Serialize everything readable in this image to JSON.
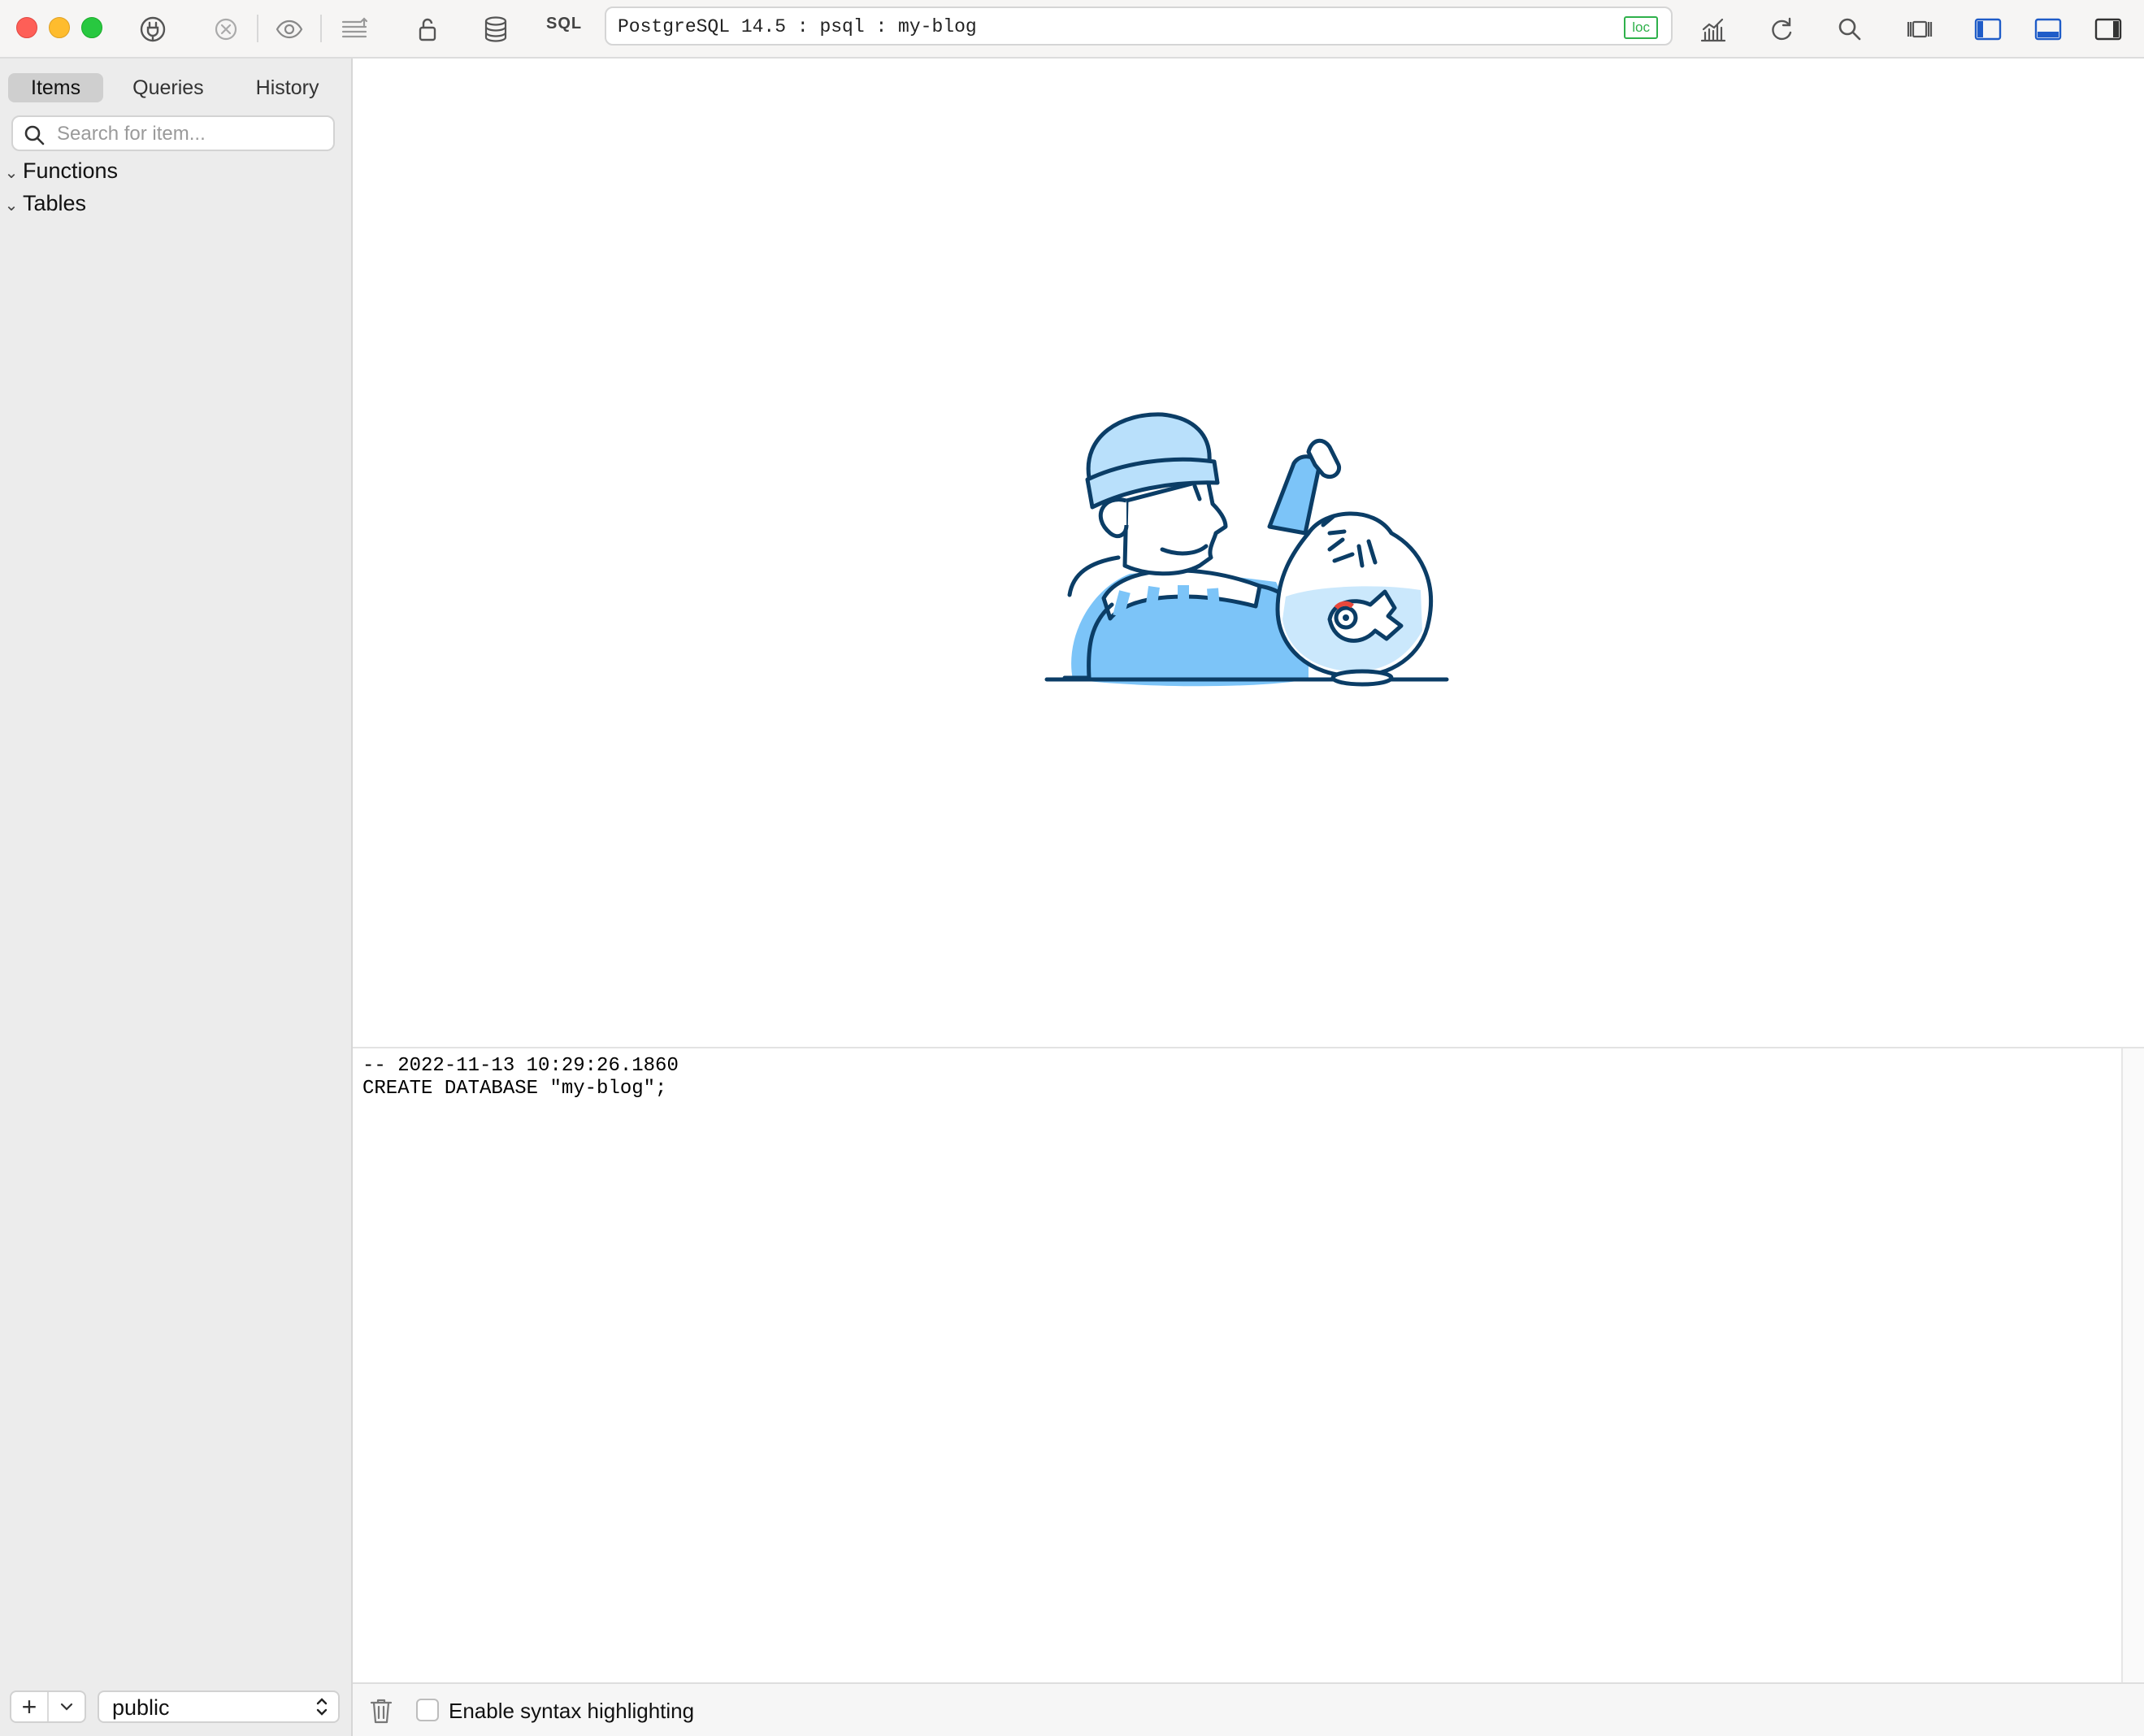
{
  "toolbar": {
    "sql_label": "SQL",
    "connection": "PostgreSQL 14.5 : psql : my-blog",
    "env_tag": "loc",
    "icons": [
      "close-window",
      "minimize-window",
      "zoom-window",
      "connection-plug-icon",
      "cancel-icon",
      "preview-eye-icon",
      "stack-icon",
      "lock-icon",
      "database-icon",
      "sql",
      "chart-icon",
      "refresh-icon",
      "search-icon",
      "split-view-icon",
      "toggle-sidebar-icon",
      "toggle-console-icon",
      "toggle-right-panel-icon"
    ],
    "accent_color": "#1f5cc8"
  },
  "sidebar": {
    "tabs": [
      {
        "label": "Items",
        "active": true
      },
      {
        "label": "Queries",
        "active": false
      },
      {
        "label": "History",
        "active": false
      }
    ],
    "search_placeholder": "Search for item...",
    "tree": [
      {
        "label": "Functions",
        "expanded": true
      },
      {
        "label": "Tables",
        "expanded": true
      }
    ],
    "footer": {
      "add_label": "+",
      "schema": "public"
    }
  },
  "console": {
    "lines": "-- 2022-11-13 10:29:26.1860\nCREATE DATABASE \"my-blog\";",
    "syntax_highlight_label": "Enable syntax highlighting",
    "syntax_highlight_checked": false
  },
  "colors": {
    "illustration_blue": "#7cc4f8",
    "illustration_stroke": "#0b3d66",
    "tag_green": "#2fb14b"
  }
}
